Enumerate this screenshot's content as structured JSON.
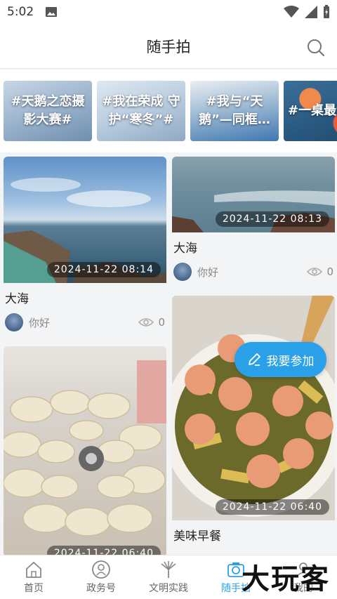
{
  "status_bar": {
    "time": "5:02"
  },
  "header": {
    "title": "随手拍"
  },
  "topics": [
    {
      "label": "#天鹅之恋摄影大赛#"
    },
    {
      "label": "#我在荣成 守护“寒冬”#"
    },
    {
      "label": "#我与“天鹅”—同框…"
    },
    {
      "label": "#一桌最满"
    }
  ],
  "feed": {
    "left": [
      {
        "date": "2024-11-22  08:14",
        "caption": "大海",
        "author": "你好",
        "views": "0"
      },
      {
        "date": "2024-11-22  06:40"
      }
    ],
    "right": [
      {
        "date": "2024-11-22  08:13",
        "caption": "大海",
        "author": "你好",
        "views": "0"
      },
      {
        "date": "2024-11-22  06:40",
        "caption": "美味早餐"
      }
    ]
  },
  "join_button": {
    "label": "我要参加"
  },
  "tabs": [
    {
      "label": "首页",
      "icon": "home-icon"
    },
    {
      "label": "政务号",
      "icon": "government-icon"
    },
    {
      "label": "文明实践",
      "icon": "civilization-icon"
    },
    {
      "label": "随手拍",
      "icon": "camera-icon",
      "active": true
    },
    {
      "label": "我的",
      "icon": "profile-icon"
    }
  ],
  "watermark": "大玩客",
  "colors": {
    "accent": "#2aa0e8"
  }
}
